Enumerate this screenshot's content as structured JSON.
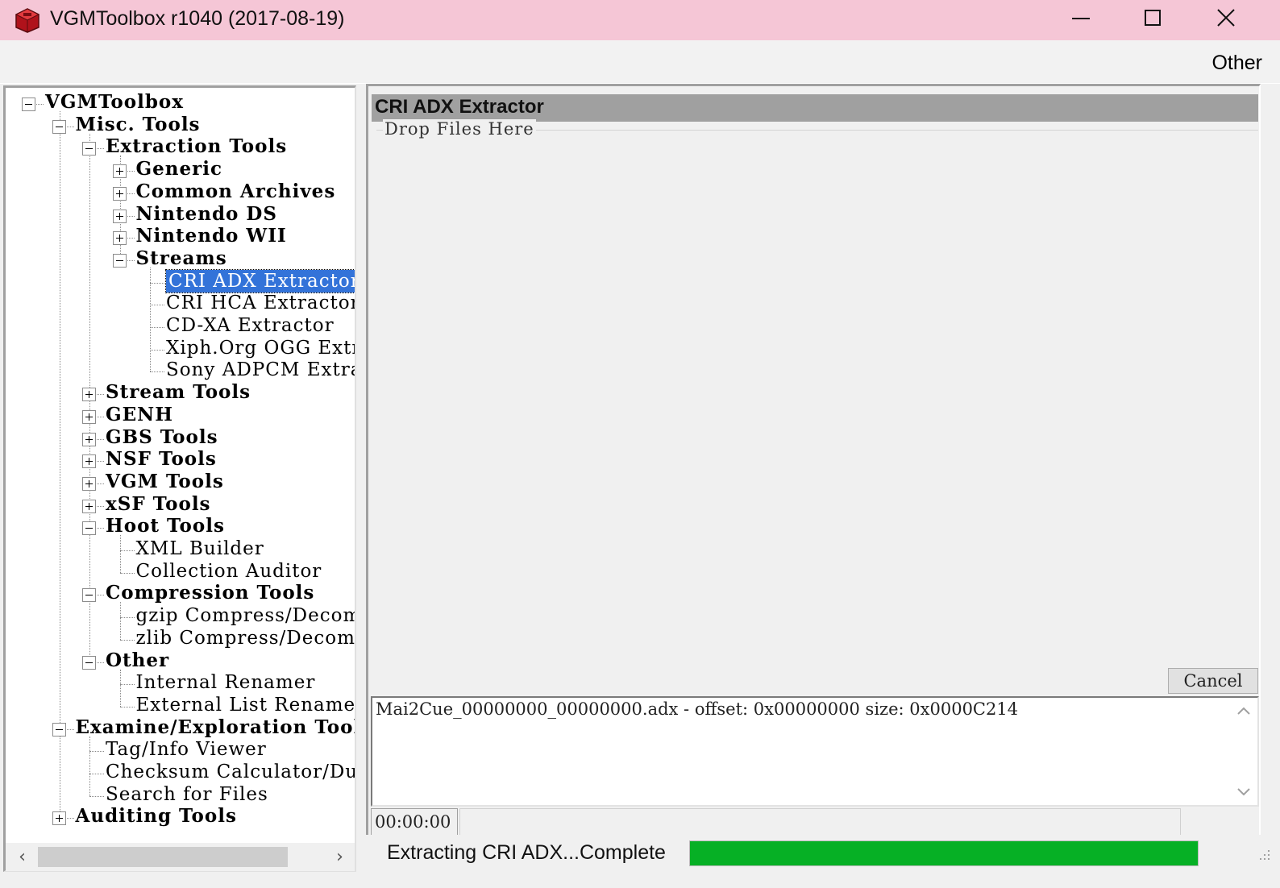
{
  "window": {
    "title": "VGMToolbox r1040 (2017-08-19)",
    "icon": "red-toolbox-icon",
    "controls": [
      "minimize",
      "maximize",
      "close"
    ]
  },
  "menu": {
    "other_label": "Other"
  },
  "tree": {
    "selected": "CRI ADX Extractor",
    "nodes": [
      {
        "id": "vgmtoolbox",
        "label": "VGMToolbox",
        "level": 0,
        "expander": "minus",
        "bold": true
      },
      {
        "id": "misc-tools",
        "label": "Misc. Tools",
        "level": 1,
        "expander": "minus",
        "bold": true
      },
      {
        "id": "extraction-tools",
        "label": "Extraction Tools",
        "level": 2,
        "expander": "minus",
        "bold": true
      },
      {
        "id": "generic",
        "label": "Generic",
        "level": 3,
        "expander": "plus",
        "bold": true
      },
      {
        "id": "common-archives",
        "label": "Common Archives",
        "level": 3,
        "expander": "plus",
        "bold": true
      },
      {
        "id": "nintendo-ds",
        "label": "Nintendo DS",
        "level": 3,
        "expander": "plus",
        "bold": true
      },
      {
        "id": "nintendo-wii",
        "label": "Nintendo WII",
        "level": 3,
        "expander": "plus",
        "bold": true
      },
      {
        "id": "streams",
        "label": "Streams",
        "level": 3,
        "expander": "minus",
        "bold": true
      },
      {
        "id": "cri-adx-extractor",
        "label": "CRI ADX Extractor",
        "level": 4,
        "expander": "none",
        "bold": false
      },
      {
        "id": "cri-hca-extractor",
        "label": "CRI HCA Extractor",
        "level": 4,
        "expander": "none",
        "bold": false
      },
      {
        "id": "cd-xa-extractor",
        "label": "CD-XA Extractor",
        "level": 4,
        "expander": "none",
        "bold": false
      },
      {
        "id": "xiph-org-ogg-extractor",
        "label": "Xiph.Org OGG Extrac",
        "level": 4,
        "expander": "none",
        "bold": false
      },
      {
        "id": "sony-adpcm-extractor",
        "label": "Sony ADPCM Extractor",
        "level": 4,
        "expander": "none",
        "bold": false
      },
      {
        "id": "stream-tools",
        "label": "Stream Tools",
        "level": 2,
        "expander": "plus",
        "bold": true
      },
      {
        "id": "genh",
        "label": "GENH",
        "level": 2,
        "expander": "plus",
        "bold": true
      },
      {
        "id": "gbs-tools",
        "label": "GBS Tools",
        "level": 2,
        "expander": "plus",
        "bold": true
      },
      {
        "id": "nsf-tools",
        "label": "NSF Tools",
        "level": 2,
        "expander": "plus",
        "bold": true
      },
      {
        "id": "vgm-tools",
        "label": "VGM Tools",
        "level": 2,
        "expander": "plus",
        "bold": true
      },
      {
        "id": "xsf-tools",
        "label": "xSF Tools",
        "level": 2,
        "expander": "plus",
        "bold": true
      },
      {
        "id": "hoot-tools",
        "label": "Hoot Tools",
        "level": 2,
        "expander": "minus",
        "bold": true
      },
      {
        "id": "xml-builder",
        "label": "XML Builder",
        "level": 3,
        "expander": "none",
        "bold": false
      },
      {
        "id": "collection-auditor",
        "label": "Collection Auditor",
        "level": 3,
        "expander": "none",
        "bold": false
      },
      {
        "id": "compression-tools",
        "label": "Compression Tools",
        "level": 2,
        "expander": "minus",
        "bold": true
      },
      {
        "id": "gzip-compress",
        "label": "gzip Compress/Decompres",
        "level": 3,
        "expander": "none",
        "bold": false
      },
      {
        "id": "zlib-compress",
        "label": "zlib Compress/Decompres",
        "level": 3,
        "expander": "none",
        "bold": false
      },
      {
        "id": "other",
        "label": "Other",
        "level": 2,
        "expander": "minus",
        "bold": true
      },
      {
        "id": "internal-renamer",
        "label": "Internal Renamer",
        "level": 3,
        "expander": "none",
        "bold": false
      },
      {
        "id": "external-list-renamer",
        "label": "External List Renamer",
        "level": 3,
        "expander": "none",
        "bold": false
      },
      {
        "id": "examine-exploration-tools",
        "label": "Examine/Exploration Tools",
        "level": 1,
        "expander": "minus",
        "bold": true
      },
      {
        "id": "tag-info-viewer",
        "label": "Tag/Info Viewer",
        "level": 2,
        "expander": "none",
        "bold": false
      },
      {
        "id": "checksum-calculator",
        "label": "Checksum Calculator/Dupe F",
        "level": 2,
        "expander": "none",
        "bold": false
      },
      {
        "id": "search-for-files",
        "label": "Search for Files",
        "level": 2,
        "expander": "none",
        "bold": false
      },
      {
        "id": "auditing-tools",
        "label": "Auditing Tools",
        "level": 1,
        "expander": "plus",
        "bold": true
      }
    ]
  },
  "panel": {
    "header": "CRI ADX Extractor",
    "drop_label": "Drop Files Here",
    "cancel_label": "Cancel",
    "output_line": "Mai2Cue_00000000_00000000.adx - offset: 0x00000000 size: 0x0000C214",
    "elapsed": "00:00:00"
  },
  "status": {
    "text": "Extracting CRI ADX...Complete",
    "progress_fraction": 1.0,
    "progress_color": "#06b025"
  },
  "colors": {
    "titlebar": "#f5c6d6",
    "selection": "#3373d9",
    "panel_header": "#a0a0a0"
  }
}
